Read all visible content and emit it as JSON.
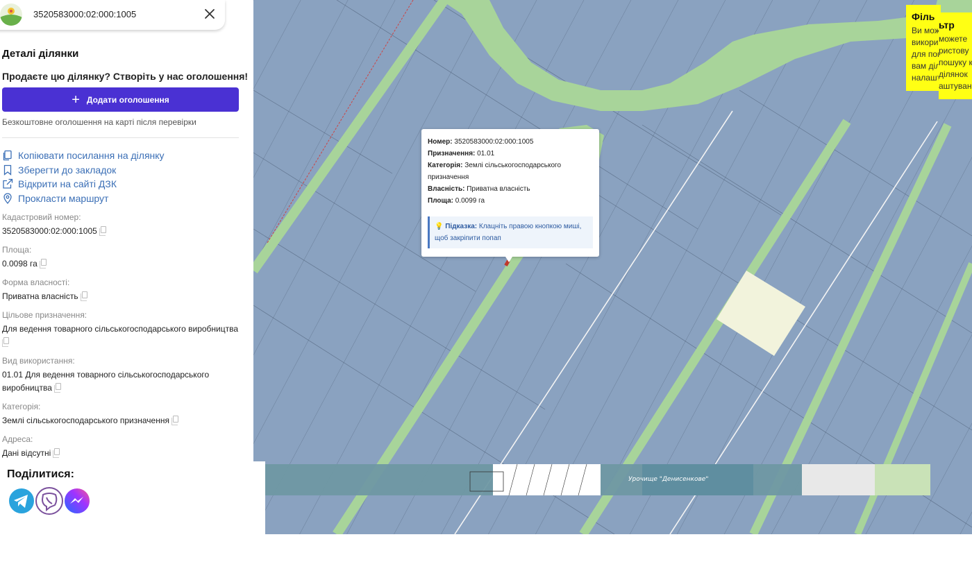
{
  "search": {
    "query": "3520583000:02:000:1005"
  },
  "panel": {
    "title": "Деталі ділянки",
    "promo": "Продаєте цю ділянку? Створіть у нас оголошення!",
    "add_button": "Додати оголошення",
    "free_note": "Безкоштовне оголошення на карті після перевірки",
    "actions": [
      {
        "label": "Копіювати посилання на ділянку",
        "icon": "copy-link-icon"
      },
      {
        "label": "Зберегти до закладок",
        "icon": "bookmark-icon"
      },
      {
        "label": "Відкрити на сайті ДЗК",
        "icon": "external-link-icon"
      },
      {
        "label": "Прокласти маршрут",
        "icon": "location-pin-icon"
      }
    ],
    "fields": [
      {
        "label": "Кадастровий номер:",
        "value": "3520583000:02:000:1005"
      },
      {
        "label": "Площа:",
        "value": "0.0098 га"
      },
      {
        "label": "Форма власності:",
        "value": "Приватна власність"
      },
      {
        "label": "Цільове призначення:",
        "value": "Для ведення товарного сільськогосподарського виробництва"
      },
      {
        "label": "Вид використання:",
        "value": "01.01 Для ведення товарного сільськогосподарського виробництва"
      },
      {
        "label": "Категорія:",
        "value": "Землі сільськогосподарського призначення"
      },
      {
        "label": "Адреса:",
        "value": "Дані відсутні"
      }
    ],
    "share_title": "Поділитися:",
    "share_icons": [
      "telegram-icon",
      "viber-icon",
      "messenger-icon"
    ]
  },
  "popup": {
    "number_label": "Номер:",
    "number": "3520583000:02:000:1005",
    "purpose_label": "Призначення:",
    "purpose": "01.01",
    "category_label": "Категорія:",
    "category": "Землі сільськогосподарського призначення",
    "ownership_label": "Власність:",
    "ownership": "Приватна власність",
    "area_label": "Площа:",
    "area": "0.0099 га",
    "hint_label": "Підказка:",
    "hint": "Клацніть правою кнопкою миші, щоб закріпити попап"
  },
  "filter_note": {
    "title_a": "Філь",
    "lines_a": [
      "Ви мож",
      "викори",
      "для пош",
      "вам діл",
      "налашт"
    ],
    "title_b": "ьтр",
    "lines_b": [
      "можете",
      "ристову",
      "пошуку к",
      "ділянок",
      "аштуванн"
    ]
  },
  "map_labels": {
    "tract": "Урочище \"Денисенкове\""
  },
  "colors": {
    "parcel": "#8aa2c0",
    "green_strip": "#a8d49a",
    "accent": "#4a31d3",
    "link": "#3b6fb6",
    "highlight": "#f2f3dc"
  }
}
